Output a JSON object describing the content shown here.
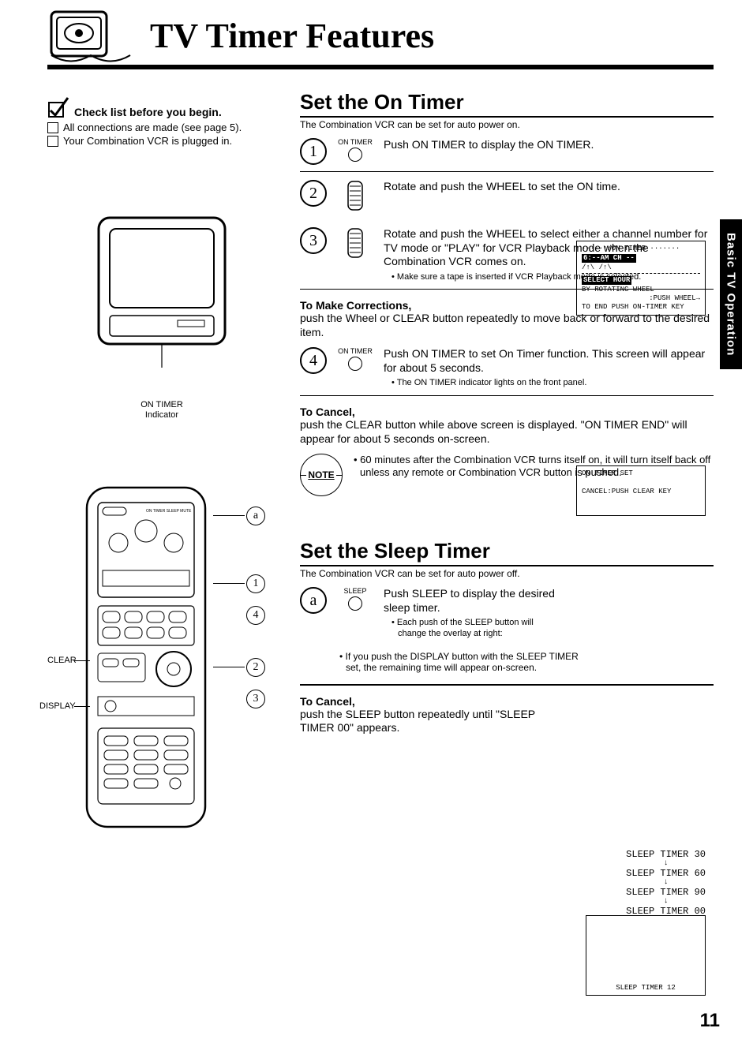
{
  "title": "TV Timer Features",
  "pageNumber": "11",
  "sideTab": "Basic TV Operation",
  "checklist": {
    "heading": "Check list before you begin.",
    "items": [
      "All connections are made (see page 5).",
      "Your Combination VCR is plugged in."
    ]
  },
  "tvFigure": {
    "captionLine1": "ON TIMER",
    "captionLine2": "Indicator"
  },
  "remoteLabels": {
    "clear": "CLEAR",
    "display": "DISPLAY",
    "a": "a",
    "s1": "1",
    "s4": "4",
    "s2": "2",
    "s3": "3"
  },
  "onTimer": {
    "heading": "Set the On Timer",
    "sub": "The Combination VCR can be set for auto power on.",
    "step1": {
      "icon": "ON TIMER",
      "text": "Push ON TIMER to display the ON TIMER."
    },
    "step2": {
      "text": "Rotate and push the WHEEL to set the ON time."
    },
    "step3": {
      "text": "Rotate and push the WHEEL to select either a channel number for TV mode or \"PLAY\" for VCR Playback mode when the Combination VCR comes on.",
      "bullet": "Make sure a tape is inserted if VCR Playback mode is selected."
    },
    "corrections": {
      "head": "To Make Corrections,",
      "text": "push the Wheel or CLEAR button repeatedly to move back or forward to the desired item."
    },
    "step4": {
      "icon": "ON TIMER",
      "text": "Push ON TIMER to set On Timer function. This screen will appear for about 5 seconds.",
      "bullet": "The ON TIMER indicator lights on the front panel."
    },
    "cancel": {
      "head": "To Cancel,",
      "text": "push the CLEAR button while above screen is displayed. \"ON TIMER END\" will appear for about 5 seconds on-screen."
    },
    "note": "60 minutes after the Combination VCR turns itself on, it will turn itself back off unless any remote or Combination VCR button is pushed.",
    "noteLabel": "NOTE",
    "osd1": {
      "line1": "·····↑/ON TIMER ·······",
      "line2": "6:--AM  CH --",
      "line3": "/↑\\ /↑\\",
      "line4": "SELECT HOUR",
      "line5": "BY ROTATING WHEEL",
      "line6": ":PUSH WHEEL→",
      "line7": "TO END PUSH ON-TIMER KEY"
    },
    "osd2": {
      "line1": "ON TIMER SET",
      "line2": "CANCEL:PUSH CLEAR KEY"
    }
  },
  "sleepTimer": {
    "heading": "Set the Sleep Timer",
    "sub": "The Combination VCR can be set for auto power off.",
    "stepA": {
      "letter": "a",
      "icon": "SLEEP",
      "text": "Push SLEEP to display the desired sleep timer.",
      "bullet1": "Each push of the SLEEP button will change the overlay at right:",
      "bullet2": "If you push the DISPLAY button with the SLEEP TIMER set, the remaining time will appear on-screen."
    },
    "cancel": {
      "head": "To Cancel,",
      "text": "push the SLEEP button repeatedly until \"SLEEP TIMER 00\" appears."
    },
    "list": [
      "SLEEP TIMER 30",
      "SLEEP TIMER 60",
      "SLEEP TIMER 90",
      "SLEEP TIMER 00"
    ],
    "osd3": "SLEEP TIMER 12"
  }
}
